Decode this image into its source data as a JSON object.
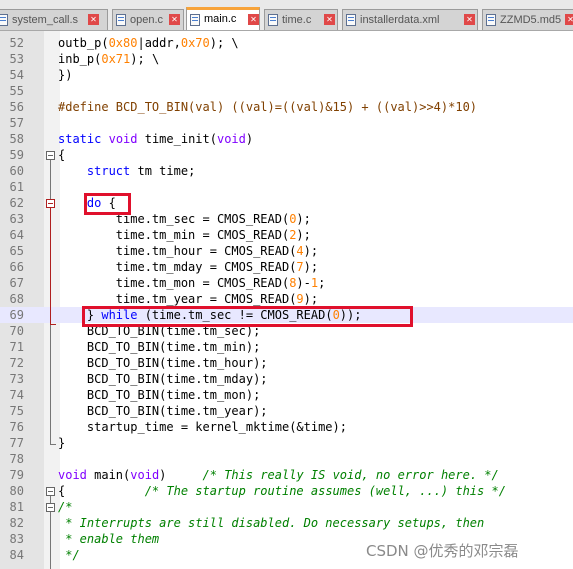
{
  "tabs": [
    {
      "label": "system_call.s",
      "active": false
    },
    {
      "label": "open.c",
      "active": false
    },
    {
      "label": "main.c",
      "active": true
    },
    {
      "label": "time.c",
      "active": false
    },
    {
      "label": "installerdata.xml",
      "active": false
    },
    {
      "label": "ZZMD5.md5",
      "active": false
    }
  ],
  "code": {
    "lines": [
      {
        "num": "52",
        "html": "outb_p(<span class=\"nm\">0x80</span>|addr,<span class=\"nm\">0x70</span>); \\"
      },
      {
        "num": "53",
        "html": "inb_p(<span class=\"nm\">0x71</span>); \\"
      },
      {
        "num": "54",
        "html": "})"
      },
      {
        "num": "55",
        "html": ""
      },
      {
        "num": "56",
        "html": "<span class=\"pp\">#define BCD_TO_BIN(val) ((val)=((val)&amp;15) + ((val)&gt;&gt;4)*10)</span>"
      },
      {
        "num": "57",
        "html": ""
      },
      {
        "num": "58",
        "html": "<span class=\"kw\">static</span> <span class=\"ty\">void</span> time_init(<span class=\"ty\">void</span>)"
      },
      {
        "num": "59",
        "html": "{"
      },
      {
        "num": "60",
        "html": "    <span class=\"kw\">struct</span> tm time;"
      },
      {
        "num": "61",
        "html": ""
      },
      {
        "num": "62",
        "html": "    <span class=\"kw\">do</span> {"
      },
      {
        "num": "63",
        "html": "        time.tm_sec = CMOS_READ(<span class=\"nm\">0</span>);"
      },
      {
        "num": "64",
        "html": "        time.tm_min = CMOS_READ(<span class=\"nm\">2</span>);"
      },
      {
        "num": "65",
        "html": "        time.tm_hour = CMOS_READ(<span class=\"nm\">4</span>);"
      },
      {
        "num": "66",
        "html": "        time.tm_mday = CMOS_READ(<span class=\"nm\">7</span>);"
      },
      {
        "num": "67",
        "html": "        time.tm_mon = CMOS_READ(<span class=\"nm\">8</span>)-<span class=\"nm\">1</span>;"
      },
      {
        "num": "68",
        "html": "        time.tm_year = CMOS_READ(<span class=\"nm\">9</span>);"
      },
      {
        "num": "69",
        "html": "    } <span class=\"kw\">while</span> (time.tm_sec != CMOS_READ(<span class=\"nm\">0</span>));"
      },
      {
        "num": "70",
        "html": "    BCD_TO_BIN(time.tm_sec);"
      },
      {
        "num": "71",
        "html": "    BCD_TO_BIN(time.tm_min);"
      },
      {
        "num": "72",
        "html": "    BCD_TO_BIN(time.tm_hour);"
      },
      {
        "num": "73",
        "html": "    BCD_TO_BIN(time.tm_mday);"
      },
      {
        "num": "74",
        "html": "    BCD_TO_BIN(time.tm_mon);"
      },
      {
        "num": "75",
        "html": "    BCD_TO_BIN(time.tm_year);"
      },
      {
        "num": "76",
        "html": "    startup_time = kernel_mktime(&amp;time);"
      },
      {
        "num": "77",
        "html": "}"
      },
      {
        "num": "78",
        "html": ""
      },
      {
        "num": "79",
        "html": "<span class=\"ty\">void</span> main(<span class=\"ty\">void</span>)     <span class=\"cm\">/* This really IS void, no error here. */</span>"
      },
      {
        "num": "80",
        "html": "{           <span class=\"cm\">/* The startup routine assumes (well, ...) this */</span>"
      },
      {
        "num": "81",
        "html": "<span class=\"cm\">/*</span>"
      },
      {
        "num": "82",
        "html": "<span class=\"cm\"> * Interrupts are still disabled. Do necessary setups, then</span>"
      },
      {
        "num": "83",
        "html": "<span class=\"cm\"> * enable them</span>"
      },
      {
        "num": "84",
        "html": "<span class=\"cm\"> */</span>"
      }
    ]
  },
  "watermark": "CSDN @优秀的邓宗磊"
}
